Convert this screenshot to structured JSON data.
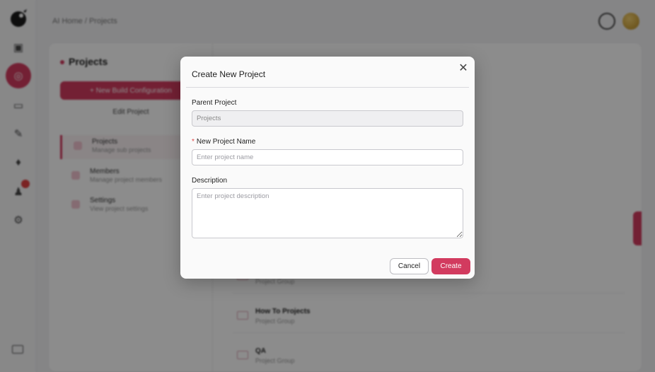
{
  "background": {
    "breadcrumb": "AI Home / Projects",
    "sidebar": {
      "title": "Projects",
      "primary_button": "+ New Build Configuration",
      "secondary_button": "Edit Project",
      "items": [
        {
          "title": "Projects",
          "subtitle": "Manage sub projects"
        },
        {
          "title": "Members",
          "subtitle": "Manage project members"
        },
        {
          "title": "Settings",
          "subtitle": "View project settings"
        }
      ]
    },
    "rows": [
      {
        "title": "",
        "subtitle": "Project Group"
      },
      {
        "title": "How To Projects",
        "subtitle": "Project Group"
      },
      {
        "title": "QA",
        "subtitle": "Project Group"
      }
    ]
  },
  "modal": {
    "title": "Create New Project",
    "parent_label": "Parent Project",
    "parent_value": "Projects",
    "name_required_mark": "*",
    "name_label": "New Project Name",
    "name_placeholder": "Enter project name",
    "description_label": "Description",
    "description_placeholder": "Enter project description",
    "cancel_label": "Cancel",
    "create_label": "Create",
    "close_glyph": "✕"
  },
  "colors": {
    "accent": "#d23b5f",
    "overlay": "rgba(0,0,0,0.45)"
  }
}
